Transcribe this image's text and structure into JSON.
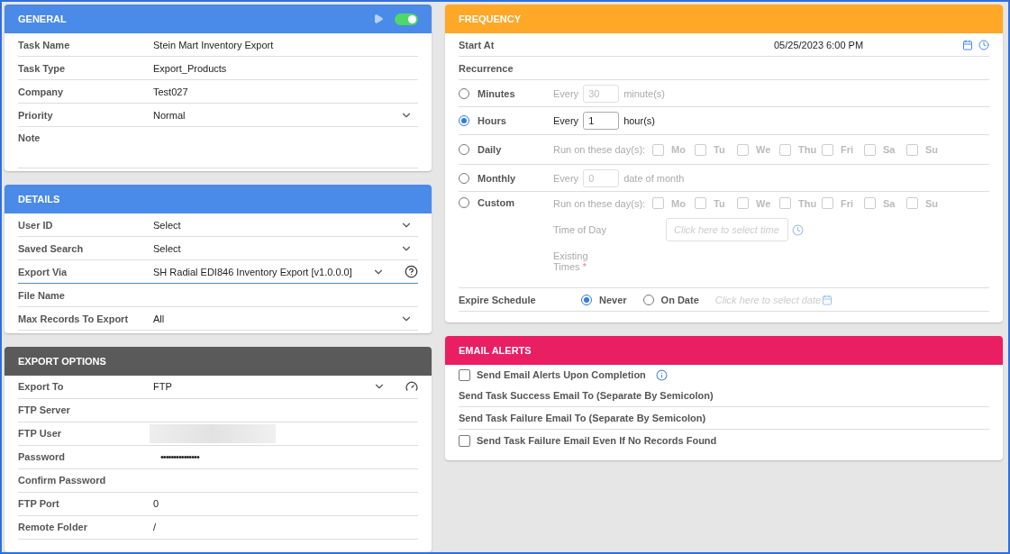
{
  "general": {
    "title": "GENERAL",
    "toggle": {
      "on": true
    },
    "fields": [
      {
        "kind": "text",
        "label": "Task Name",
        "value": "Stein Mart Inventory Export"
      },
      {
        "kind": "text",
        "label": "Task Type",
        "value": "Export_Products"
      },
      {
        "kind": "text",
        "label": "Company",
        "value": "Test027"
      },
      {
        "kind": "select",
        "label": "Priority",
        "value": "Normal"
      },
      {
        "kind": "note",
        "label": "Note"
      }
    ]
  },
  "details": {
    "title": "DETAILS",
    "fields": [
      {
        "kind": "select",
        "label": "User ID",
        "value": "Select"
      },
      {
        "kind": "select",
        "label": "Saved Search",
        "value": "Select"
      },
      {
        "kind": "select-help",
        "label": "Export Via",
        "value": "SH Radial EDI846 Inventory Export [v1.0.0.0]",
        "focused": true
      },
      {
        "kind": "text",
        "label": "File Name"
      },
      {
        "kind": "select",
        "label": "Max Records To Export",
        "value": "All"
      }
    ]
  },
  "export_options": {
    "title": "EXPORT OPTIONS",
    "fields": [
      {
        "kind": "select-gauge",
        "label": "Export To",
        "value": "FTP"
      },
      {
        "kind": "text",
        "label": "FTP Server"
      },
      {
        "kind": "masked",
        "label": "FTP User"
      },
      {
        "kind": "password",
        "label": "Password",
        "value": "•••••••••••••••"
      },
      {
        "kind": "text",
        "label": "Confirm Password"
      },
      {
        "kind": "text",
        "label": "FTP Port",
        "value": "0"
      },
      {
        "kind": "text",
        "label": "Remote Folder",
        "value": "/"
      }
    ]
  },
  "frequency": {
    "title": "FREQUENCY",
    "start_at": {
      "label": "Start At",
      "value": "05/25/2023 6:00 PM"
    },
    "recurrence_label": "Recurrence",
    "options": [
      {
        "kind": "interval",
        "label": "Minutes",
        "selected": false,
        "disabled": true,
        "prefix": "Every",
        "value": "30",
        "suffix": "minute(s)"
      },
      {
        "kind": "interval",
        "label": "Hours",
        "selected": true,
        "disabled": false,
        "prefix": "Every",
        "value": "1",
        "suffix": "hour(s)"
      },
      {
        "kind": "days",
        "label": "Daily",
        "selected": false,
        "disabled": true,
        "prefix": "Run on these day(s):",
        "days": [
          {
            "label": "Mo",
            "checked": false
          },
          {
            "label": "Tu",
            "checked": false
          },
          {
            "label": "We",
            "checked": false
          },
          {
            "label": "Thu",
            "checked": false
          },
          {
            "label": "Fri",
            "checked": false
          },
          {
            "label": "Sa",
            "checked": false
          },
          {
            "label": "Su",
            "checked": false
          }
        ]
      },
      {
        "kind": "interval",
        "label": "Monthly",
        "selected": false,
        "disabled": true,
        "prefix": "Every",
        "value": "0",
        "suffix": "date of month"
      },
      {
        "kind": "custom",
        "label": "Custom",
        "selected": false,
        "disabled": true,
        "prefix": "Run on these day(s):",
        "days": [
          {
            "label": "Mo",
            "checked": false
          },
          {
            "label": "Tu",
            "checked": false
          },
          {
            "label": "We",
            "checked": false
          },
          {
            "label": "Thu",
            "checked": false
          },
          {
            "label": "Fri",
            "checked": false
          },
          {
            "label": "Sa",
            "checked": false
          },
          {
            "label": "Su",
            "checked": false
          }
        ],
        "time_label": "Time of Day",
        "time_placeholder": "Click here to select time",
        "existing_label": "Existing Times",
        "existing_mark": "*"
      }
    ],
    "expire": {
      "label": "Expire Schedule",
      "options": [
        {
          "label": "Never",
          "selected": true
        },
        {
          "label": "On Date",
          "selected": false
        }
      ],
      "date_placeholder": "Click here to select date"
    }
  },
  "email_alerts": {
    "title": "EMAIL ALERTS",
    "items": [
      {
        "kind": "checkbox",
        "label": "Send Email Alerts Upon Completion",
        "checked": false,
        "info": true
      },
      {
        "kind": "field",
        "label": "Send Task Success Email To (Separate By Semicolon)"
      },
      {
        "kind": "field",
        "label": "Send Task Failure Email To (Separate By Semicolon)"
      },
      {
        "kind": "checkbox",
        "label": "Send Task Failure Email Even If No Records Found",
        "checked": false,
        "info": false
      }
    ]
  }
}
